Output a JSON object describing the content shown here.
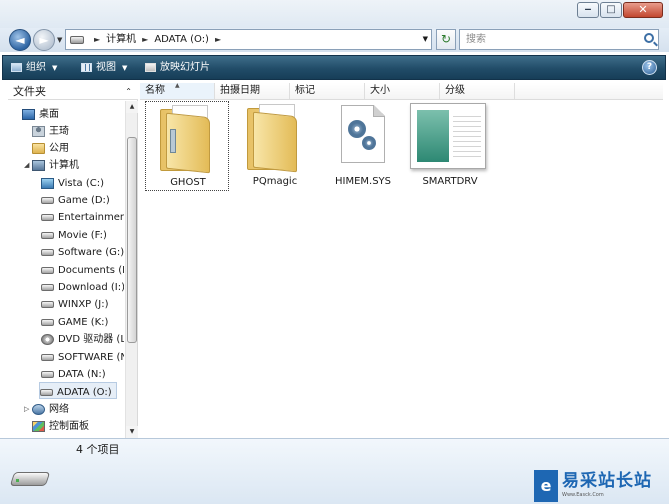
{
  "window": {
    "minimize_glyph": "‒",
    "maximize_glyph": "□",
    "close_glyph": "✕"
  },
  "address": {
    "crumbs": [
      "计算机",
      "ADATA (O:)"
    ],
    "search_placeholder": "搜索"
  },
  "toolbar": {
    "organize": "组织",
    "views": "视图",
    "slideshow": "放映幻灯片",
    "help": "?"
  },
  "navpane": {
    "header": "文件夹",
    "items": [
      {
        "label": "桌面",
        "icon": "desktop-icon"
      },
      {
        "label": "王琦",
        "icon": "user-folder-icon"
      },
      {
        "label": "公用",
        "icon": "folder-icon"
      },
      {
        "label": "计算机",
        "icon": "computer-icon"
      },
      {
        "label": "Vista (C:)",
        "icon": "system-drive-icon"
      },
      {
        "label": "Game (D:)",
        "icon": "drive-icon"
      },
      {
        "label": "Entertainment",
        "icon": "drive-icon"
      },
      {
        "label": "Movie (F:)",
        "icon": "drive-icon"
      },
      {
        "label": "Software (G:)",
        "icon": "drive-icon"
      },
      {
        "label": "Documents (H",
        "icon": "drive-icon"
      },
      {
        "label": "Download (I:)",
        "icon": "drive-icon"
      },
      {
        "label": "WINXP (J:)",
        "icon": "drive-icon"
      },
      {
        "label": "GAME (K:)",
        "icon": "drive-icon"
      },
      {
        "label": "DVD 驱动器 (L",
        "icon": "dvd-drive-icon"
      },
      {
        "label": "SOFTWARE (N",
        "icon": "drive-icon"
      },
      {
        "label": "DATA (N:)",
        "icon": "drive-icon"
      },
      {
        "label": "ADATA (O:)",
        "icon": "removable-drive-icon",
        "selected": true
      },
      {
        "label": "网络",
        "icon": "network-icon"
      },
      {
        "label": "控制面板",
        "icon": "control-panel-icon"
      }
    ]
  },
  "columns": [
    "名称",
    "拍摄日期",
    "标记",
    "大小",
    "分级"
  ],
  "files": [
    {
      "name": "GHOST",
      "type": "folder"
    },
    {
      "name": "PQmagic",
      "type": "folder"
    },
    {
      "name": "HIMEM.SYS",
      "type": "system-file"
    },
    {
      "name": "SMARTDRV",
      "type": "document"
    }
  ],
  "details": {
    "item_count": "4 个项目"
  },
  "watermark": {
    "glyph": "e",
    "text": "易采站长站",
    "sub": "Www.Easck.Com"
  },
  "colors": {
    "toolbar": "#214c68",
    "selection": "#e6eef7",
    "watermark": "#1e67b3"
  }
}
